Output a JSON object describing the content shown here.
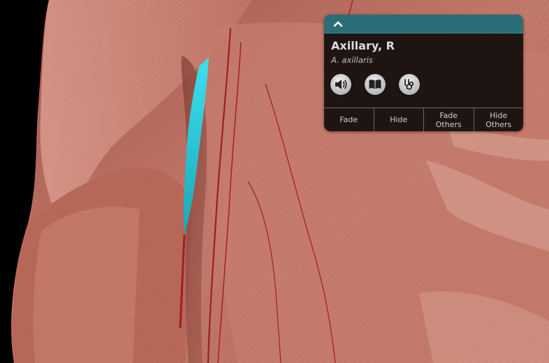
{
  "structure": {
    "name": "Axillary, R",
    "latin_name": "A. axillaris"
  },
  "panel": {
    "collapse_icon": "chevron-up-icon",
    "icons": [
      "speaker-icon",
      "book-icon",
      "stethoscope-icon"
    ],
    "actions": {
      "fade": "Fade",
      "hide": "Hide",
      "fade_others_line1": "Fade",
      "fade_others_line2": "Others",
      "hide_others_line1": "Hide",
      "hide_others_line2": "Others"
    }
  },
  "colors": {
    "header_teal": "#2b6e77",
    "highlight_cyan": "#27c8d8",
    "muscle": "#b86a5c",
    "background": "#000000"
  }
}
